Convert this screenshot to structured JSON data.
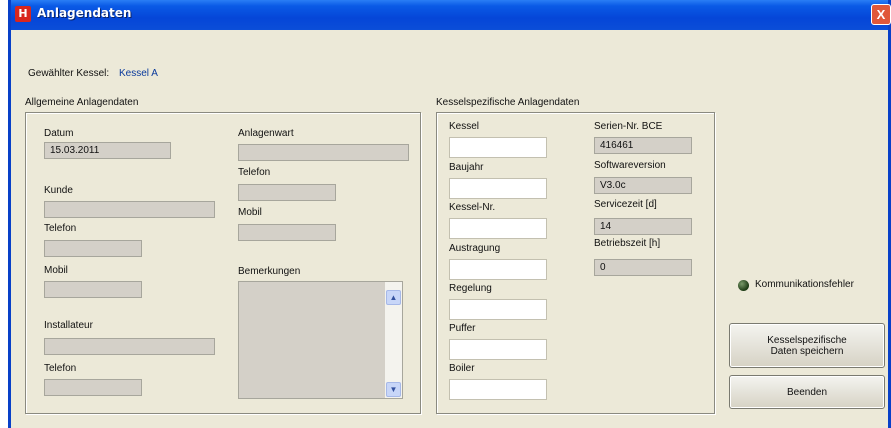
{
  "window": {
    "title": "Anlagendaten",
    "icon_letter": "H",
    "close_glyph": "X"
  },
  "selection": {
    "label": "Gewählter Kessel:",
    "value": "Kessel A"
  },
  "general": {
    "group_title": "Allgemeine Anlagendaten",
    "datum_label": "Datum",
    "datum_value": "15.03.2011",
    "kunde_label": "Kunde",
    "kunde_value": "",
    "telefon_label": "Telefon",
    "telefon_value": "",
    "mobil_label": "Mobil",
    "mobil_value": "",
    "installateur_label": "Installateur",
    "installateur_value": "",
    "inst_telefon_label": "Telefon",
    "inst_telefon_value": "",
    "anlagenwart_label": "Anlagenwart",
    "anlagenwart_value": "",
    "wart_telefon_label": "Telefon",
    "wart_telefon_value": "",
    "wart_mobil_label": "Mobil",
    "wart_mobil_value": "",
    "bemerkungen_label": "Bemerkungen",
    "bemerkungen_value": "",
    "scroll_up": "▲",
    "scroll_down": "▼"
  },
  "boiler": {
    "group_title": "Kesselspezifische Anlagendaten",
    "kessel_label": "Kessel",
    "kessel_value": "",
    "baujahr_label": "Baujahr",
    "baujahr_value": "",
    "kesselnr_label": "Kessel-Nr.",
    "kesselnr_value": "",
    "austragung_label": "Austragung",
    "austragung_value": "",
    "regelung_label": "Regelung",
    "regelung_value": "",
    "puffer_label": "Puffer",
    "puffer_value": "",
    "boiler_label": "Boiler",
    "boiler_value": "",
    "serien_label": "Serien-Nr. BCE",
    "serien_value": "416461",
    "software_label": "Softwareversion",
    "software_value": "V3.0c",
    "servicezeit_label": "Servicezeit [d]",
    "servicezeit_value": "14",
    "betriebszeit_label": "Betriebszeit [h]",
    "betriebszeit_value": "0"
  },
  "status": {
    "label": "Kommunikationsfehler",
    "led_color": "#2e4a22"
  },
  "buttons": {
    "save_line1": "Kesselspezifische",
    "save_line2": "Daten speichern",
    "exit": "Beenden"
  }
}
